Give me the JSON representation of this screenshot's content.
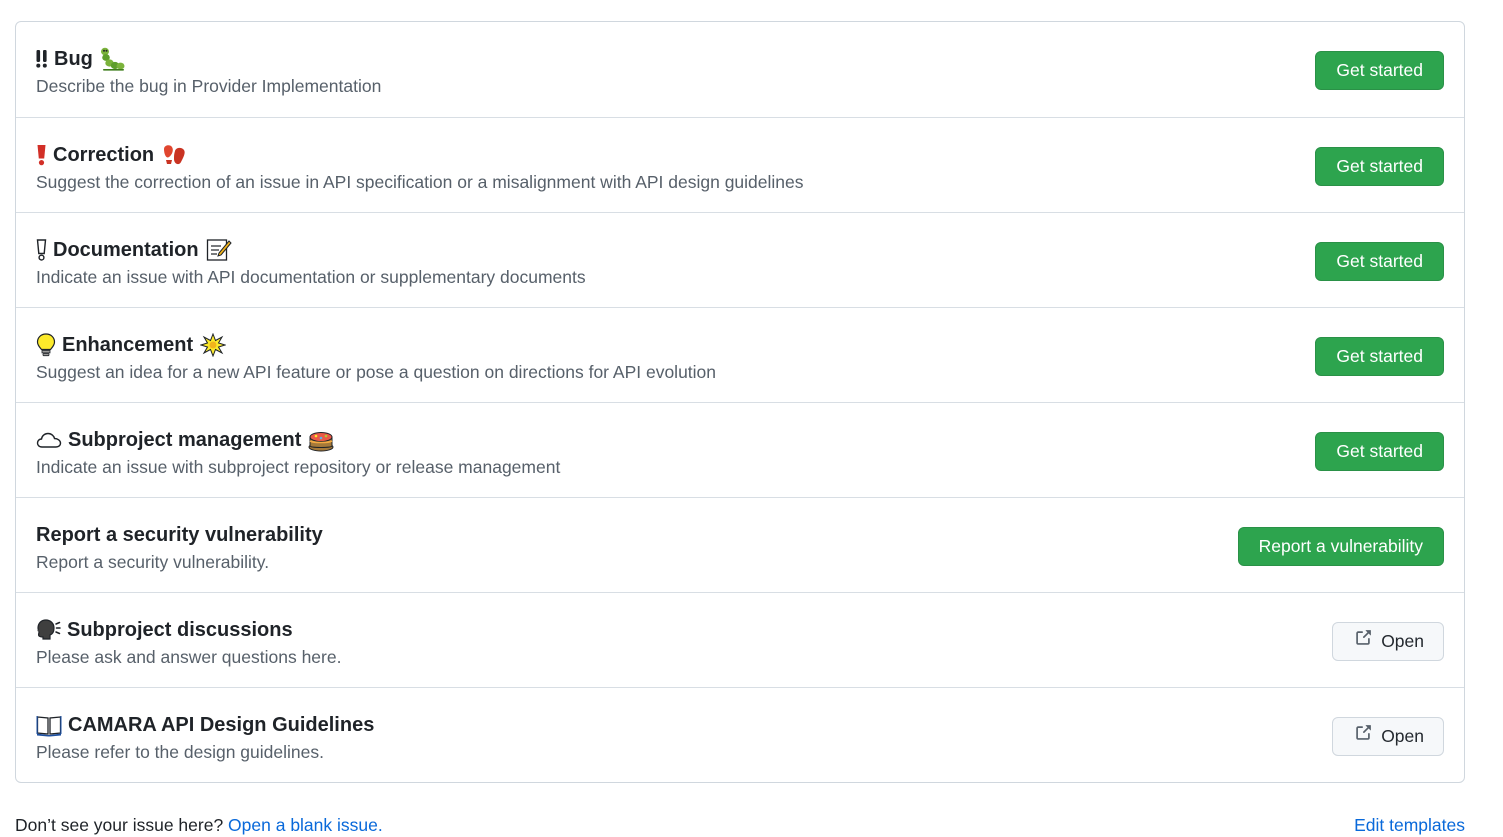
{
  "templates": [
    {
      "title": "‼️ Bug",
      "title_text": "Bug",
      "lead_icon": "double-exclamation-icon",
      "trail_icon": "bug-icon",
      "description": "Describe the bug in Provider Implementation",
      "button": "Get started",
      "button_style": "primary"
    },
    {
      "title_text": "Correction",
      "lead_icon": "red-exclamation-icon",
      "trail_icon": "footprints-icon",
      "description": "Suggest the correction of an issue in API specification or a misalignment with API design guidelines",
      "button": "Get started",
      "button_style": "primary"
    },
    {
      "title_text": "Documentation",
      "lead_icon": "white-exclamation-icon",
      "trail_icon": "memo-icon",
      "description": "Indicate an issue with API documentation or supplementary documents",
      "button": "Get started",
      "button_style": "primary"
    },
    {
      "title_text": "Enhancement",
      "lead_icon": "light-bulb-icon",
      "trail_icon": "sparkle-burst-icon",
      "description": "Suggest an idea for a new API feature or pose a question on directions for API evolution",
      "button": "Get started",
      "button_style": "primary"
    },
    {
      "title_text": "Subproject management",
      "lead_icon": "cloud-icon",
      "trail_icon": "cake-icon",
      "description": "Indicate an issue with subproject repository or release management",
      "button": "Get started",
      "button_style": "primary"
    },
    {
      "title_text": "Report a security vulnerability",
      "lead_icon": "",
      "trail_icon": "",
      "description": "Report a security vulnerability.",
      "button": "Report a vulnerability",
      "button_style": "primary"
    },
    {
      "title_text": "Subproject discussions",
      "lead_icon": "speaking-head-icon",
      "trail_icon": "",
      "description": "Please ask and answer questions here.",
      "button": "Open",
      "button_style": "outline",
      "button_icon": "external-link-icon"
    },
    {
      "title_text": "CAMARA API Design Guidelines",
      "lead_icon": "open-book-icon",
      "trail_icon": "",
      "description": "Please refer to the design guidelines.",
      "button": "Open",
      "button_style": "outline",
      "button_icon": "external-link-icon"
    }
  ],
  "footer": {
    "prompt": "Don’t see your issue here?",
    "blank_issue_link": "Open a blank issue.",
    "edit_templates_link": "Edit templates"
  },
  "colors": {
    "primary_button": "#2da44e",
    "link": "#0969da",
    "border": "#d0d7de"
  }
}
